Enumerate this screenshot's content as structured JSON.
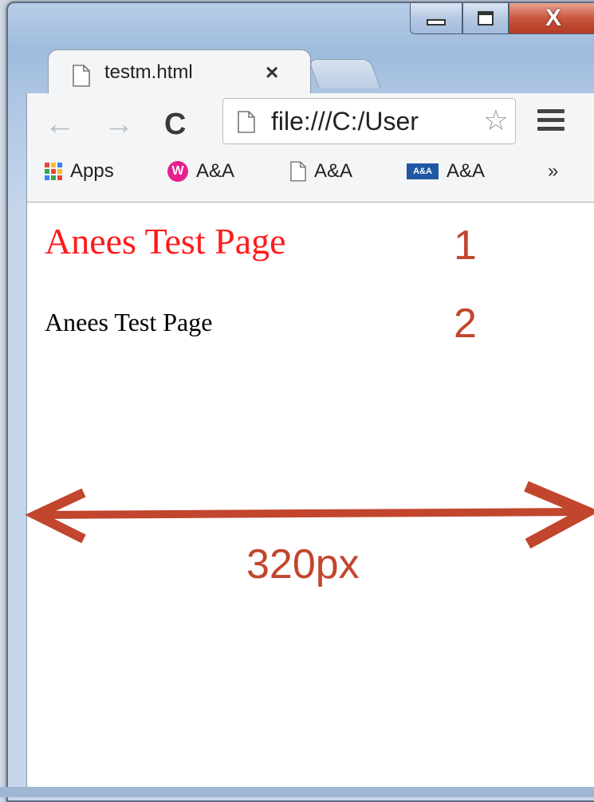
{
  "tab": {
    "title": "testm.html",
    "close_glyph": "×",
    "icon": "page-icon"
  },
  "window_controls": {
    "minimize": "minimize-icon",
    "maximize": "maximize-icon",
    "close": "X"
  },
  "toolbar": {
    "back_glyph": "←",
    "forward_glyph": "→",
    "reload_glyph": "C",
    "url": "file:///C:/User",
    "star_glyph": "☆",
    "menu": "menu-icon"
  },
  "bookmarks": [
    {
      "label": "Apps",
      "icon": "apps-grid-icon"
    },
    {
      "label": "A&A",
      "icon": "wamp-icon",
      "icon_text": "W"
    },
    {
      "label": "A&A",
      "icon": "page-icon"
    },
    {
      "label": "A&A",
      "icon": "aa-icon",
      "icon_text": "A&A"
    }
  ],
  "bookmarks_more": "»",
  "page": {
    "heading": "Anees Test Page",
    "paragraph": "Anees Test Page"
  },
  "annotations": {
    "label_1": "1",
    "label_2": "2",
    "width_label": "320px",
    "color": "#c2452d"
  },
  "colors": {
    "heading": "#ff1a1a",
    "chrome_bg": "#f4f5f6",
    "frame": "#9fbbdd"
  }
}
